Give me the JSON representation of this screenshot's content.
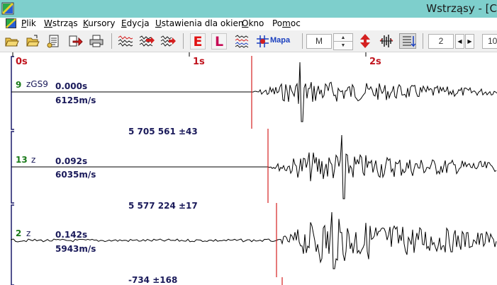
{
  "window": {
    "title": "Wstrząsy  - [C"
  },
  "menu": {
    "items": [
      {
        "pre": "",
        "ul": "P",
        "post": "lik"
      },
      {
        "pre": "",
        "ul": "W",
        "post": "strząs"
      },
      {
        "pre": "",
        "ul": "K",
        "post": "ursory"
      },
      {
        "pre": "",
        "ul": "E",
        "post": "dycja"
      },
      {
        "pre": "",
        "ul": "U",
        "post": "stawienia dla okien"
      },
      {
        "pre": "",
        "ul": "O",
        "post": "kno"
      },
      {
        "pre": "Po",
        "ul": "m",
        "post": "oc"
      }
    ]
  },
  "toolbar": {
    "e_label": "E",
    "l_label": "L",
    "mapa_label": "Mapa",
    "mode_value": "M",
    "spin_up": "▲",
    "spin_down": "▼",
    "count_value": "2",
    "count_left": "◀",
    "count_right": "▶",
    "zoom_value": "10"
  },
  "ruler": {
    "ticks": [
      {
        "label": "0s"
      },
      {
        "label": "1s"
      },
      {
        "label": "2s"
      }
    ]
  },
  "channels": [
    {
      "id": "9",
      "name": "zGS9",
      "time": "0.000s",
      "velocity": "6125m/s",
      "distance": "5 705 561   ±43"
    },
    {
      "id": "13",
      "name": "z",
      "time": "0.092s",
      "velocity": "6035m/s",
      "distance": "5 577 224   ±17"
    },
    {
      "id": "2",
      "name": "z",
      "time": "0.142s",
      "velocity": "5943m/s",
      "distance": "-734   ±168"
    }
  ],
  "colors": {
    "titlebar": "#7ecfcc",
    "pick_line": "#d42020",
    "trace": "#000000",
    "frame": "#1a1a6a",
    "channel_id": "#1a7a1a"
  }
}
